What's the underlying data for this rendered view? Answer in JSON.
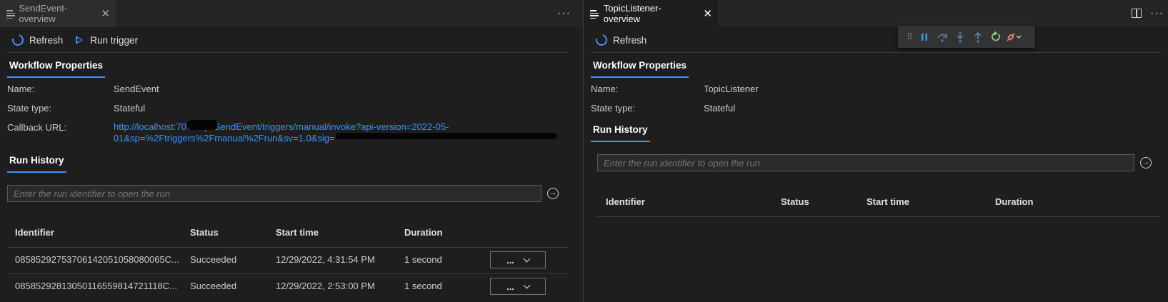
{
  "left_tab": {
    "title": "SendEvent-overview",
    "close": "✕",
    "more": "···"
  },
  "right_tab": {
    "title": "TopicListener-overview",
    "close": "✕",
    "more": "···"
  },
  "left": {
    "toolbar": {
      "refresh_label": "Refresh",
      "run_trigger_label": "Run trigger"
    },
    "properties_tab": "Workflow Properties",
    "props": {
      "name_label": "Name:",
      "name_value": "SendEvent",
      "state_label": "State type:",
      "state_value": "Stateful",
      "callback_label": "Callback URL:",
      "callback_line1": "http://localhost:7071/api/SendEvent/triggers/manual/invoke?api-version=2022-05-",
      "callback_line2": "01&sp=%2Ftriggers%2Fmanual%2Frun&sv=1.0&sig="
    },
    "run_history_tab": "Run History",
    "run_input_placeholder": "Enter the run identifier to open the run",
    "table": {
      "headers": [
        "Identifier",
        "Status",
        "Start time",
        "Duration"
      ],
      "rows": [
        {
          "identifier": "08585292753706142051058080065C...",
          "status": "Succeeded",
          "start": "12/29/2022, 4:31:54 PM",
          "duration": "1 second",
          "action": "..."
        },
        {
          "identifier": "08585292813050116559814721118C...",
          "status": "Succeeded",
          "start": "12/29/2022, 2:53:00 PM",
          "duration": "1 second",
          "action": "..."
        }
      ]
    }
  },
  "right": {
    "toolbar": {
      "refresh_label": "Refresh"
    },
    "properties_tab": "Workflow Properties",
    "props": {
      "name_label": "Name:",
      "name_value": "TopicListener",
      "state_label": "State type:",
      "state_value": "Stateful"
    },
    "run_history_tab": "Run History",
    "run_input_placeholder": "Enter the run identifier to open the run",
    "table": {
      "headers": [
        "Identifier",
        "Status",
        "Start time",
        "Duration"
      ]
    }
  },
  "debug_toolbar": {
    "items": [
      "drag-handle-icon",
      "pause-icon",
      "step-over-icon",
      "step-into-icon",
      "step-out-icon",
      "restart-icon",
      "disconnect-icon"
    ],
    "colors": {
      "pause": "#3794ff",
      "restart": "#89d185",
      "disconnect": "#f48771",
      "steps": "#75beff"
    }
  },
  "colors": {
    "accent": "#3794ff",
    "background": "#1e1e1e",
    "tabbar": "#252526"
  }
}
